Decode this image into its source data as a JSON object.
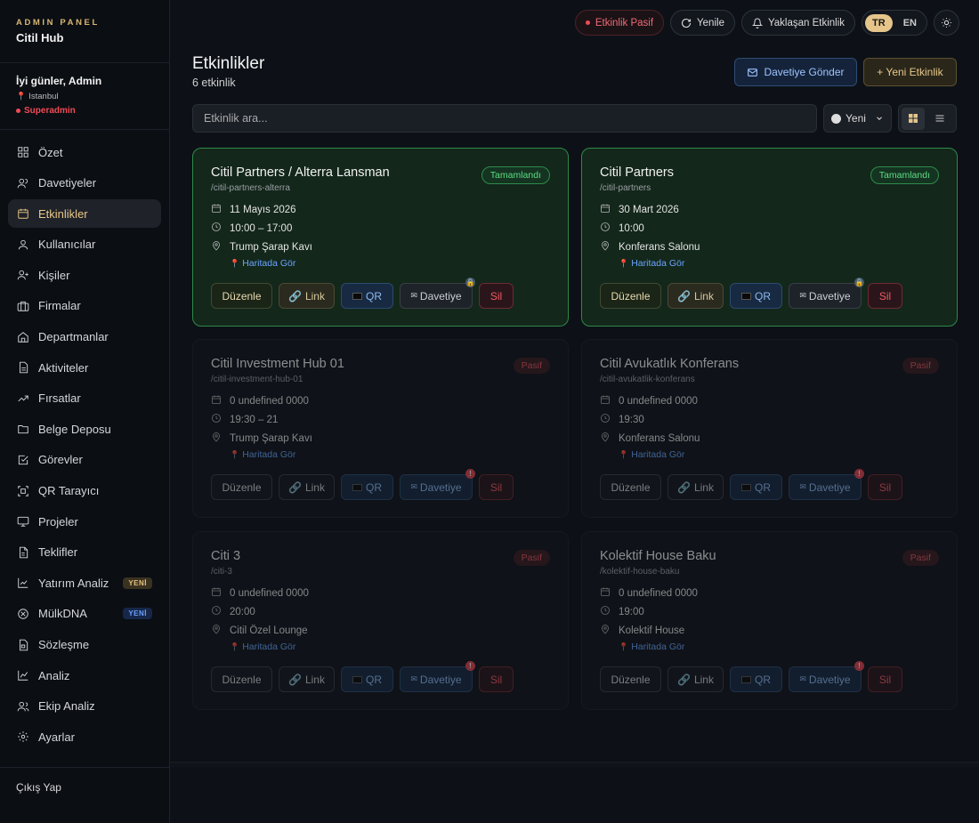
{
  "brand": {
    "top": "ADMIN PANEL",
    "name": "Citil Hub"
  },
  "user": {
    "greeting": "İyi günler, Admin",
    "city": "Istanbul",
    "role": "Superadmin"
  },
  "nav": [
    {
      "label": "Özet",
      "icon": "grid-icon"
    },
    {
      "label": "Davetiyeler",
      "icon": "users-icon"
    },
    {
      "label": "Etkinlikler",
      "icon": "calendar-icon",
      "active": true
    },
    {
      "label": "Kullanıcılar",
      "icon": "user-icon"
    },
    {
      "label": "Kişiler",
      "icon": "user-plus-icon"
    },
    {
      "label": "Firmalar",
      "icon": "briefcase-icon"
    },
    {
      "label": "Departmanlar",
      "icon": "home-icon"
    },
    {
      "label": "Aktiviteler",
      "icon": "file-icon"
    },
    {
      "label": "Fırsatlar",
      "icon": "trending-icon"
    },
    {
      "label": "Belge Deposu",
      "icon": "folder-icon"
    },
    {
      "label": "Görevler",
      "icon": "check-square-icon"
    },
    {
      "label": "QR Tarayıcı",
      "icon": "scan-icon"
    },
    {
      "label": "Projeler",
      "icon": "monitor-icon"
    },
    {
      "label": "Teklifler",
      "icon": "document-icon"
    },
    {
      "label": "Yatırım Analiz",
      "icon": "chart-icon",
      "badge": "YENİ",
      "badge_color": "gold"
    },
    {
      "label": "MülkDNA",
      "icon": "dna-icon",
      "badge": "YENİ",
      "badge_color": "blue"
    },
    {
      "label": "Sözleşme",
      "icon": "contract-icon"
    },
    {
      "label": "Analiz",
      "icon": "line-chart-icon"
    },
    {
      "label": "Ekip Analiz",
      "icon": "team-icon"
    },
    {
      "label": "Ayarlar",
      "icon": "gear-icon"
    }
  ],
  "logout": "Çıkış Yap",
  "topbar": {
    "status": "Etkinlik Pasif",
    "refresh": "Yenile",
    "upcoming": "Yaklaşan Etkinlik",
    "lang_tr": "TR",
    "lang_en": "EN"
  },
  "page": {
    "title": "Etkinlikler",
    "count": "6 etkinlik",
    "invite_button": "Davetiye Gönder",
    "new_button": "+ Yeni Etkinlik"
  },
  "search": {
    "placeholder": "Etkinlik ara..."
  },
  "sort": {
    "value": "Yeni"
  },
  "colors": {
    "accent": "#e5c58a",
    "success": "#5fdc84",
    "danger": "#ef4b55",
    "link": "#6aa6ff"
  },
  "actions": {
    "edit": "Düzenle",
    "link": "Link",
    "qr": "QR",
    "invite": "Davetiye",
    "delete": "Sil"
  },
  "map_label": "Haritada Gör",
  "events": [
    {
      "title": "Citil Partners / Alterra Lansman",
      "slug": "/citil-partners-alterra",
      "status": "Tamamlandı",
      "state": "done",
      "date": "11 Mayıs 2026",
      "time": "10:00 – 17:00",
      "place": "Trump Şarap Kavı",
      "flag": "lock"
    },
    {
      "title": "Citil Partners",
      "slug": "/citil-partners",
      "status": "Tamamlandı",
      "state": "done",
      "date": "30 Mart 2026",
      "time": "10:00",
      "place": "Konferans Salonu",
      "flag": "lock"
    },
    {
      "title": "Citil Investment Hub 01",
      "slug": "/citil-investment-hub-01",
      "status": "Pasif",
      "state": "passive",
      "date": "0 undefined 0000",
      "time": "19:30 – 21",
      "place": "Trump Şarap Kavı",
      "flag": "warn"
    },
    {
      "title": "Citil Avukatlık Konferans",
      "slug": "/citil-avukatlik-konferans",
      "status": "Pasif",
      "state": "passive",
      "date": "0 undefined 0000",
      "time": "19:30",
      "place": "Konferans Salonu",
      "flag": "warn"
    },
    {
      "title": "Citi 3",
      "slug": "/citi-3",
      "status": "Pasif",
      "state": "passive",
      "date": "0 undefined 0000",
      "time": "20:00",
      "place": "Citil Özel Lounge",
      "flag": "warn"
    },
    {
      "title": "Kolektif House Baku",
      "slug": "/kolektif-house-baku",
      "status": "Pasif",
      "state": "passive",
      "date": "0 undefined 0000",
      "time": "19:00",
      "place": "Kolektif House",
      "flag": "warn"
    }
  ]
}
